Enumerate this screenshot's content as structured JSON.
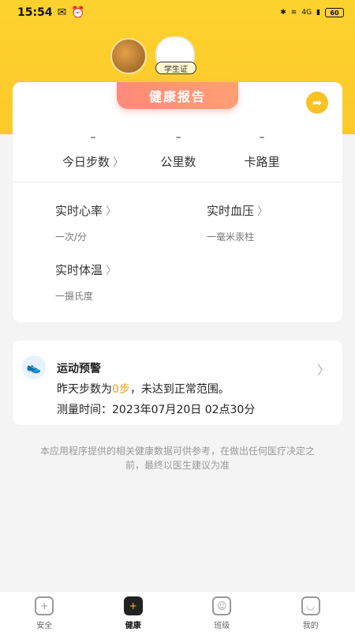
{
  "status_bar": {
    "time": "15:54",
    "battery": "60",
    "network": "4G"
  },
  "header": {
    "badge": "学生证"
  },
  "report": {
    "tab_title": "健康报告",
    "stats": [
      {
        "value": "–",
        "label": "今日步数"
      },
      {
        "value": "–",
        "label": "公里数"
      },
      {
        "value": "–",
        "label": "卡路里"
      }
    ],
    "metrics": [
      {
        "title": "实时心率",
        "sub": "一次/分"
      },
      {
        "title": "实时血压",
        "sub": "一毫米汞柱"
      },
      {
        "title": "实时体温",
        "sub": "一摄氏度"
      }
    ]
  },
  "alert": {
    "title": "运动预警",
    "line1_prefix": "昨天步数为",
    "line1_highlight": "0步",
    "line1_suffix": "，未达到正常范围。",
    "line2": "测量时间：2023年07月20日 02点30分"
  },
  "disclaimer": "本应用程序提供的相关健康数据可供参考，在做出任何医疗决定之前，最终以医生建议为准",
  "tabbar": {
    "items": [
      {
        "label": "安全"
      },
      {
        "label": "健康"
      },
      {
        "label": "班级"
      },
      {
        "label": "我的"
      }
    ]
  },
  "colors": {
    "brand": "#fcc92a",
    "highlight": "#f39b15",
    "tab_gradient": "#ff8a7a"
  }
}
